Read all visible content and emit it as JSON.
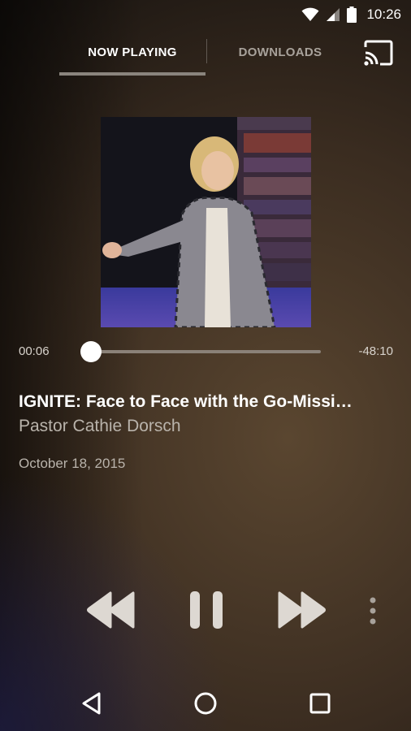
{
  "status_bar": {
    "time": "10:26"
  },
  "tabs": [
    {
      "label": "NOW PLAYING",
      "active": true
    },
    {
      "label": "DOWNLOADS",
      "active": false
    }
  ],
  "player": {
    "elapsed": "00:06",
    "remaining": "-48:10",
    "progress": 0.0,
    "title": "IGNITE: Face to Face with the Go-Missi…",
    "speaker": "Pastor Cathie Dorsch",
    "date": "October 18, 2015"
  },
  "icons": {
    "cast": "cast-icon",
    "rewind": "rewind-icon",
    "pause": "pause-icon",
    "fast_forward": "fast-forward-icon",
    "more": "more-vert-icon",
    "back": "back-icon",
    "home": "home-icon",
    "recents": "recents-icon"
  },
  "colors": {
    "accent_indicator": "#8a847d",
    "text_secondary": "#b9b3ab"
  }
}
